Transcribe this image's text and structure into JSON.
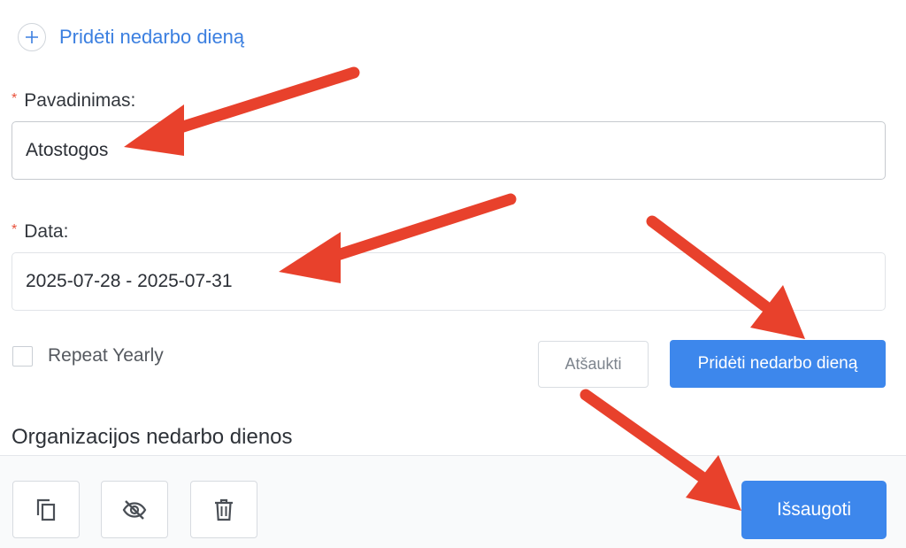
{
  "add_holiday_link": {
    "label": "Pridėti nedarbo dieną",
    "icon": "plus-icon"
  },
  "form": {
    "name": {
      "label": "Pavadinimas:",
      "required_mark": "*",
      "value": "Atostogos"
    },
    "date": {
      "label": "Data:",
      "required_mark": "*",
      "value": "2025-07-28 - 2025-07-31"
    },
    "repeat_yearly": {
      "label": "Repeat Yearly",
      "checked": false
    },
    "cancel_label": "Atšaukti",
    "submit_label": "Pridėti nedarbo dieną"
  },
  "section_title": "Organizacijos nedarbo dienos",
  "toolbar": {
    "icons": [
      "copy-icon",
      "eye-off-icon",
      "trash-icon"
    ],
    "save_label": "Išsaugoti"
  },
  "colors": {
    "primary": "#3d87ec",
    "link": "#3b7fe0",
    "required": "#e8503a",
    "annotation_arrow": "#e8412c"
  }
}
